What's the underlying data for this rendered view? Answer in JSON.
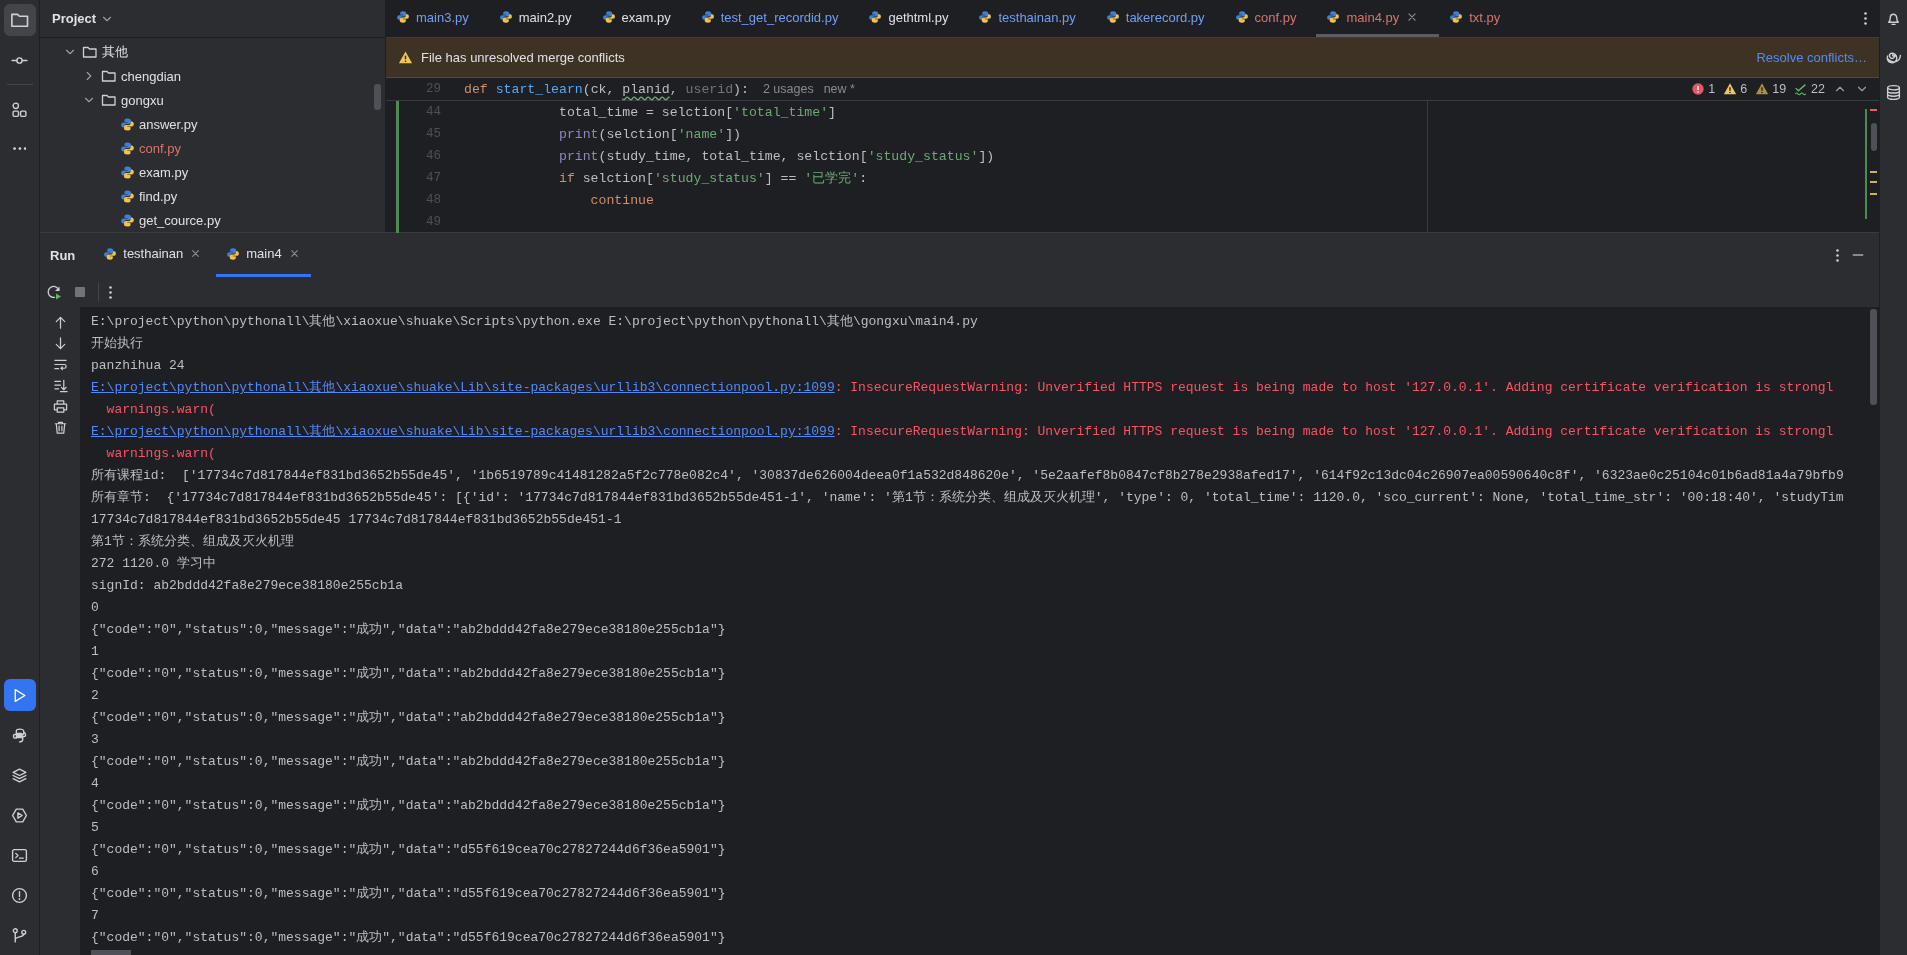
{
  "left_toolbar": {
    "top": [
      {
        "kind": "project",
        "selected": true,
        "focused": false
      },
      {
        "kind": "commit",
        "selected": false,
        "focused": false
      },
      {
        "kind": "structure",
        "selected": false,
        "focused": false
      },
      {
        "kind": "more",
        "selected": false,
        "focused": false
      }
    ],
    "bottom": [
      {
        "kind": "run",
        "selected": true,
        "focused": true
      },
      {
        "kind": "python",
        "selected": false,
        "focused": false
      },
      {
        "kind": "layers",
        "selected": false,
        "focused": false
      },
      {
        "kind": "services",
        "selected": false,
        "focused": false
      },
      {
        "kind": "terminal",
        "selected": false,
        "focused": false
      },
      {
        "kind": "problems",
        "selected": false,
        "focused": false
      },
      {
        "kind": "git",
        "selected": false,
        "focused": false
      }
    ]
  },
  "project": {
    "title": "Project",
    "tree": [
      {
        "label": "其他",
        "kind": "folder",
        "expanded": true,
        "children": [
          {
            "label": "chengdian",
            "kind": "folder",
            "expanded": false
          },
          {
            "label": "gongxu",
            "kind": "folder",
            "expanded": true,
            "children": [
              {
                "label": "answer.py",
                "kind": "file",
                "conflict": false
              },
              {
                "label": "conf.py",
                "kind": "file",
                "conflict": true
              },
              {
                "label": "exam.py",
                "kind": "file",
                "conflict": false
              },
              {
                "label": "find.py",
                "kind": "file",
                "conflict": false
              },
              {
                "label": "get_cource.py",
                "kind": "file",
                "conflict": false
              }
            ]
          }
        ]
      }
    ]
  },
  "editor": {
    "tabs": [
      {
        "label": "main3.py",
        "color": "#6f9ff7",
        "selected": false
      },
      {
        "label": "main2.py",
        "color": "#dfe1e5",
        "selected": false
      },
      {
        "label": "exam.py",
        "color": "#dfe1e5",
        "selected": false
      },
      {
        "label": "test_get_recordid.py",
        "color": "#6f9ff7",
        "selected": false
      },
      {
        "label": "gethtml.py",
        "color": "#dfe1e5",
        "selected": false
      },
      {
        "label": "testhainan.py",
        "color": "#6f9ff7",
        "selected": false
      },
      {
        "label": "takerecord.py",
        "color": "#6f9ff7",
        "selected": false
      },
      {
        "label": "conf.py",
        "color": "#d5756c",
        "selected": false
      },
      {
        "label": "main4.py",
        "color": "#d5756c",
        "selected": true
      },
      {
        "label": "txt.py",
        "color": "#d5756c",
        "selected": false
      }
    ],
    "banner": {
      "message": "File has unresolved merge conflicts",
      "action": "Resolve conflicts…"
    },
    "sticky_line": {
      "number": "29",
      "tokens": [
        {
          "kind": "keyword",
          "t": "def "
        },
        {
          "kind": "function",
          "t": "start_learn"
        },
        {
          "kind": "plain",
          "t": "(ck, "
        },
        {
          "kind": "typo",
          "t": "planid"
        },
        {
          "kind": "plain",
          "t": ", "
        },
        {
          "kind": "unused",
          "t": "userid"
        },
        {
          "kind": "plain",
          "t": "):"
        }
      ],
      "hints": [
        "2 usages",
        "new *"
      ]
    },
    "inspections": [
      {
        "kind": "error",
        "count": "1"
      },
      {
        "kind": "warning",
        "count": "6"
      },
      {
        "kind": "weak",
        "count": "19"
      },
      {
        "kind": "typo",
        "count": "22"
      }
    ],
    "lines": [
      {
        "number": "44",
        "tokens": [
          {
            "kind": "plain",
            "t": "            total_time = selction["
          },
          {
            "kind": "string",
            "t": "'total_time'"
          },
          {
            "kind": "plain",
            "t": "]"
          }
        ]
      },
      {
        "number": "45",
        "tokens": [
          {
            "kind": "builtin",
            "t": "            print"
          },
          {
            "kind": "plain",
            "t": "(selction["
          },
          {
            "kind": "string",
            "t": "'name'"
          },
          {
            "kind": "plain",
            "t": "])"
          }
        ]
      },
      {
        "number": "46",
        "tokens": [
          {
            "kind": "builtin",
            "t": "            print"
          },
          {
            "kind": "plain",
            "t": "(study_time, total_time, selction["
          },
          {
            "kind": "string",
            "t": "'study_status'"
          },
          {
            "kind": "plain",
            "t": "])"
          }
        ]
      },
      {
        "number": "47",
        "tokens": [
          {
            "kind": "keyword",
            "t": "            if"
          },
          {
            "kind": "plain",
            "t": " selction["
          },
          {
            "kind": "string",
            "t": "'study_status'"
          },
          {
            "kind": "plain",
            "t": "] == "
          },
          {
            "kind": "string",
            "t": "'已学完'"
          },
          {
            "kind": "plain",
            "t": ":"
          }
        ]
      },
      {
        "number": "48",
        "tokens": [
          {
            "kind": "keyword",
            "t": "                continue"
          }
        ]
      },
      {
        "number": "49"
      }
    ]
  },
  "run_panel": {
    "title": "Run",
    "tabs": [
      {
        "label": "testhainan",
        "selected": false
      },
      {
        "label": "main4",
        "selected": true
      }
    ],
    "console": [
      {
        "kind": "plain",
        "text": "E:\\project\\python\\pythonall\\其他\\xiaoxue\\shuake\\Scripts\\python.exe E:\\project\\python\\pythonall\\其他\\gongxu\\main4.py"
      },
      {
        "kind": "plain",
        "text": "开始执行"
      },
      {
        "kind": "plain",
        "text": "panzhihua 24"
      },
      {
        "kind": "warning",
        "link": "E:\\project\\python\\pythonall\\其他\\xiaoxue\\shuake\\Lib\\site-packages\\urllib3\\connectionpool.py:1099",
        "message": ": InsecureRequestWarning: Unverified HTTPS request is being made to host '127.0.0.1'. Adding certificate verification is strongl"
      },
      {
        "kind": "error",
        "text": "  warnings.warn("
      },
      {
        "kind": "warning",
        "link": "E:\\project\\python\\pythonall\\其他\\xiaoxue\\shuake\\Lib\\site-packages\\urllib3\\connectionpool.py:1099",
        "message": ": InsecureRequestWarning: Unverified HTTPS request is being made to host '127.0.0.1'. Adding certificate verification is strongl"
      },
      {
        "kind": "error",
        "text": "  warnings.warn("
      },
      {
        "kind": "plain",
        "text": "所有课程id:  ['17734c7d817844ef831bd3652b55de45', '1b6519789c41481282a5f2c778e082c4', '30837de626004deea0f1a532d848620e', '5e2aafef8b0847cf8b278e2938afed17', '614f92c13dc04c26907ea00590640c8f', '6323ae0c25104c01b6ad81a4a79bfb9"
      },
      {
        "kind": "plain",
        "text": "所有章节:  {'17734c7d817844ef831bd3652b55de45': [{'id': '17734c7d817844ef831bd3652b55de451-1', 'name': '第1节：系统分类、组成及灭火机理', 'type': 0, 'total_time': 1120.0, 'sco_current': None, 'total_time_str': '00:18:40', 'studyTim"
      },
      {
        "kind": "plain",
        "text": "17734c7d817844ef831bd3652b55de45 17734c7d817844ef831bd3652b55de451-1"
      },
      {
        "kind": "plain",
        "text": "第1节：系统分类、组成及灭火机理"
      },
      {
        "kind": "plain",
        "text": "272 1120.0 学习中"
      },
      {
        "kind": "plain",
        "text": "signId: ab2bddd42fa8e279ece38180e255cb1a"
      },
      {
        "kind": "plain",
        "text": "0"
      },
      {
        "kind": "plain",
        "text": "{\"code\":\"0\",\"status\":0,\"message\":\"成功\",\"data\":\"ab2bddd42fa8e279ece38180e255cb1a\"}"
      },
      {
        "kind": "plain",
        "text": "1"
      },
      {
        "kind": "plain",
        "text": "{\"code\":\"0\",\"status\":0,\"message\":\"成功\",\"data\":\"ab2bddd42fa8e279ece38180e255cb1a\"}"
      },
      {
        "kind": "plain",
        "text": "2"
      },
      {
        "kind": "plain",
        "text": "{\"code\":\"0\",\"status\":0,\"message\":\"成功\",\"data\":\"ab2bddd42fa8e279ece38180e255cb1a\"}"
      },
      {
        "kind": "plain",
        "text": "3"
      },
      {
        "kind": "plain",
        "text": "{\"code\":\"0\",\"status\":0,\"message\":\"成功\",\"data\":\"ab2bddd42fa8e279ece38180e255cb1a\"}"
      },
      {
        "kind": "plain",
        "text": "4"
      },
      {
        "kind": "plain",
        "text": "{\"code\":\"0\",\"status\":0,\"message\":\"成功\",\"data\":\"ab2bddd42fa8e279ece38180e255cb1a\"}"
      },
      {
        "kind": "plain",
        "text": "5"
      },
      {
        "kind": "plain",
        "text": "{\"code\":\"0\",\"status\":0,\"message\":\"成功\",\"data\":\"d55f619cea70c27827244d6f36ea5901\"}"
      },
      {
        "kind": "plain",
        "text": "6"
      },
      {
        "kind": "plain",
        "text": "{\"code\":\"0\",\"status\":0,\"message\":\"成功\",\"data\":\"d55f619cea70c27827244d6f36ea5901\"}"
      },
      {
        "kind": "plain",
        "text": "7"
      },
      {
        "kind": "plain",
        "text": "{\"code\":\"0\",\"status\":0,\"message\":\"成功\",\"data\":\"d55f619cea70c27827244d6f36ea5901\"}"
      }
    ]
  }
}
